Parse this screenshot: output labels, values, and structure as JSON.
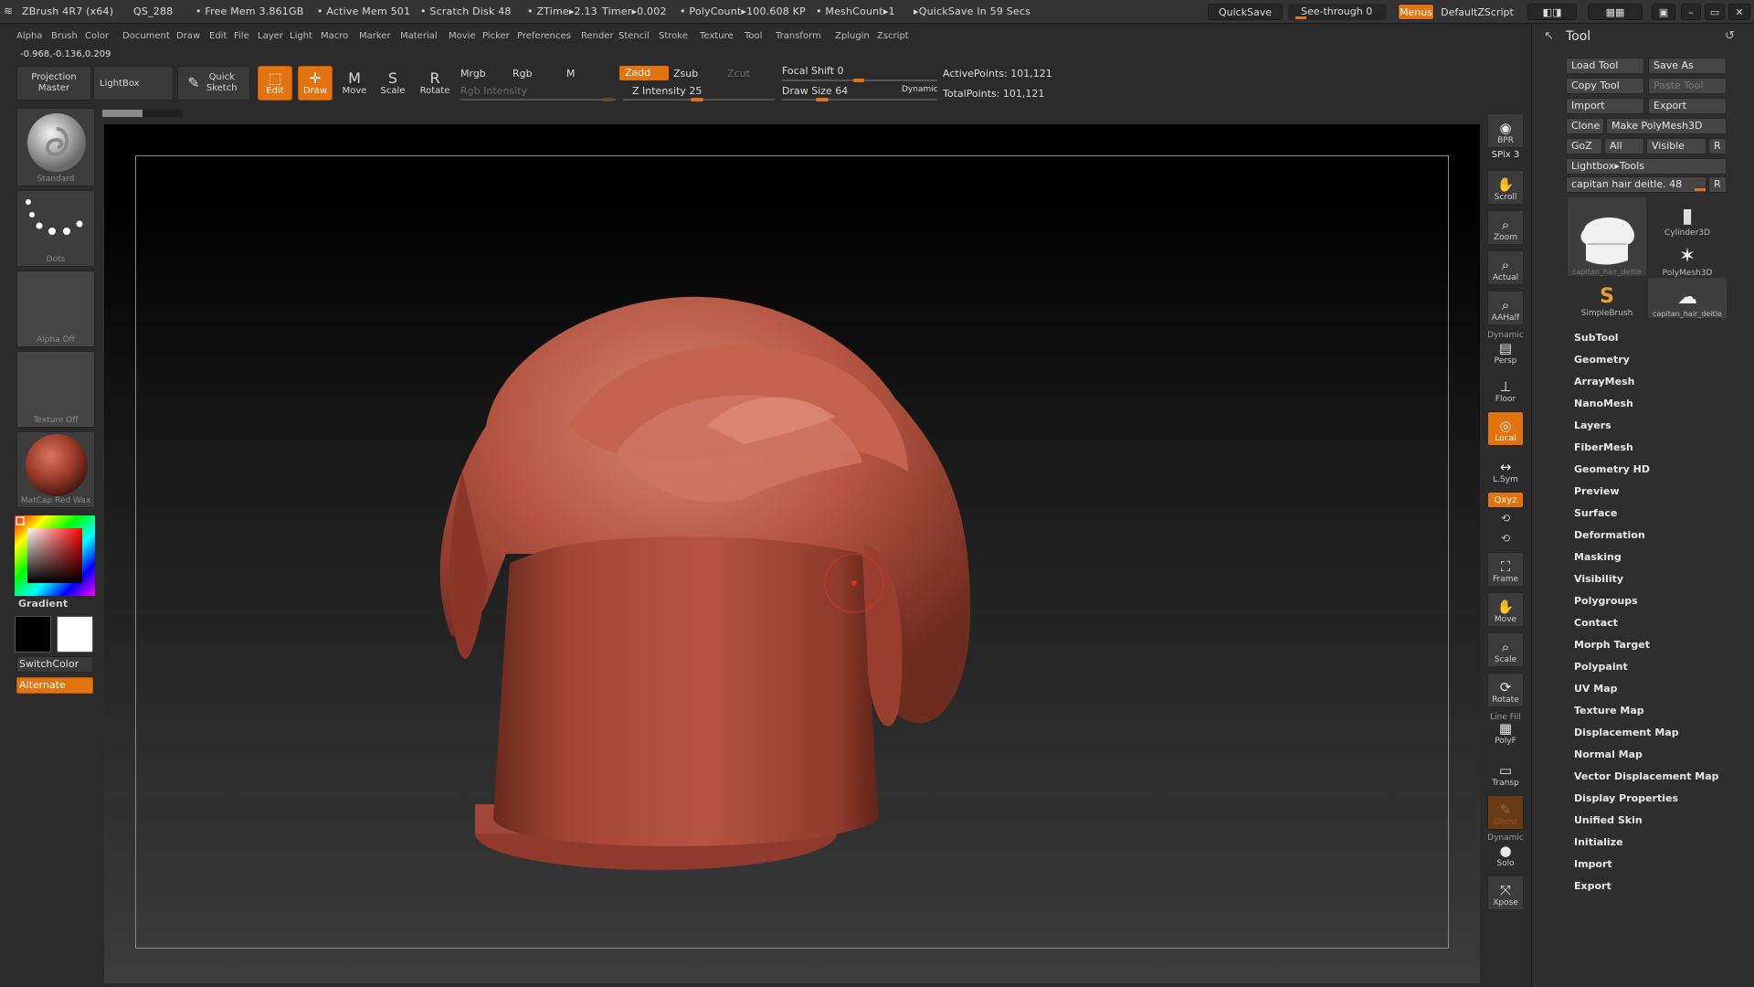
{
  "title_bar": {
    "app": "ZBrush 4R7 (x64)",
    "project": "QS_288",
    "free_mem": "• Free Mem 3.861GB",
    "active_mem": "• Active Mem 501",
    "scratch_disk": "• Scratch Disk 48",
    "ztime": "• ZTime▸2.13",
    "timer": "Timer▸0.002",
    "polycount": "• PolyCount▸100.608 KP",
    "meshcount": "• MeshCount▸1",
    "quicksave_in": "▸QuickSave In 59 Secs",
    "quicksave_btn": "QuickSave",
    "seethrough": "See-through  0",
    "menus_btn": "Menus",
    "script": "DefaultZScript"
  },
  "menu_items": [
    "Alpha",
    "Brush",
    "Color",
    "Document",
    "Draw",
    "Edit",
    "File",
    "Layer",
    "Light",
    "Macro",
    "Marker",
    "Material",
    "Movie",
    "Picker",
    "Preferences",
    "Render",
    "Stencil",
    "Stroke",
    "Texture",
    "Tool",
    "Transform",
    "Zplugin",
    "Zscript"
  ],
  "coords": "-0.968,-0.136,0.209",
  "toolbar": {
    "projection_master": "Projection Master",
    "lightbox": "LightBox",
    "quick_sketch": "Quick Sketch",
    "edit": "Edit",
    "draw": "Draw",
    "move": "Move",
    "scale": "Scale",
    "rotate": "Rotate",
    "mrgb": "Mrgb",
    "rgb": "Rgb",
    "m": "M",
    "zadd": "Zadd",
    "zsub": "Zsub",
    "zcut": "Zcut",
    "rgb_intensity": "Rgb Intensity",
    "z_intensity": "Z Intensity 25",
    "focal_shift": "Focal Shift 0",
    "draw_size": "Draw Size 64",
    "dynamic": "Dynamic",
    "active_points": "ActivePoints: 101,121",
    "total_points": "TotalPoints: 101,121"
  },
  "left_shelf": {
    "brush": "Standard",
    "stroke": "Dots",
    "alpha": "Alpha Off",
    "texture": "Texture Off",
    "material": "MatCap Red Wax",
    "gradient": "Gradient",
    "switch_color": "SwitchColor",
    "alternate": "Alternate"
  },
  "right_shelf": {
    "bpr": "BPR",
    "spix": "SPix 3",
    "scroll": "Scroll",
    "zoom": "Zoom",
    "actual": "Actual",
    "aahalf": "AAHalf",
    "dynamic": "Dynamic",
    "persp": "Persp",
    "floor": "Floor",
    "local": "Local",
    "lsym": "L.Sym",
    "xyz": "Qxyz",
    "frame": "Frame",
    "move": "Move",
    "scale": "Scale",
    "rotate": "Rotate",
    "linefill": "Line Fill",
    "polyf": "PolyF",
    "transp": "Transp",
    "ghost": "Ghost",
    "dynamic2": "Dynamic",
    "solo": "Solo",
    "xpose": "Xpose"
  },
  "tool_panel": {
    "header": "Tool",
    "load_tool": "Load Tool",
    "save_as": "Save As",
    "copy_tool": "Copy Tool",
    "paste_tool": "Paste Tool",
    "import": "Import",
    "export": "Export",
    "clone": "Clone",
    "make_polymesh": "Make PolyMesh3D",
    "goz": "GoZ",
    "all": "All",
    "visible": "Visible",
    "r": "R",
    "lightbox_tools": "Lightbox▸Tools",
    "current_tool": "capitan hair deitle. 48",
    "thumbs": {
      "t1": "capitan_hair_deitle",
      "t2": "Cylinder3D",
      "t3": "PolyMesh3D",
      "t4": "SimpleBrush",
      "t5": "capitan_hair_deitle"
    },
    "subpalettes": [
      "SubTool",
      "Geometry",
      "ArrayMesh",
      "NanoMesh",
      "Layers",
      "FiberMesh",
      "Geometry HD",
      "Preview",
      "Surface",
      "Deformation",
      "Masking",
      "Visibility",
      "Polygroups",
      "Contact",
      "Morph Target",
      "Polypaint",
      "UV Map",
      "Texture Map",
      "Displacement Map",
      "Normal Map",
      "Vector Displacement Map",
      "Display Properties",
      "Unified Skin",
      "Initialize",
      "Import",
      "Export"
    ]
  },
  "colors": {
    "accent": "#e2730e",
    "model": "#b5503e"
  }
}
